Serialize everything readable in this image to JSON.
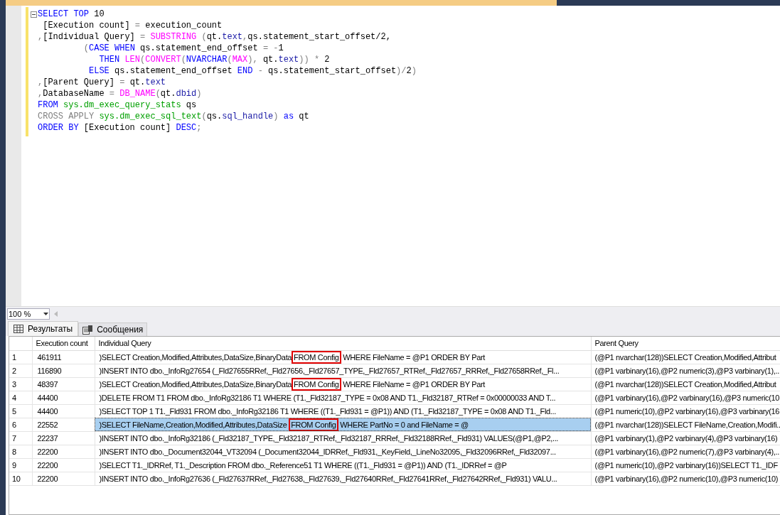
{
  "editor": {
    "lines": [
      [
        {
          "t": "SELECT",
          "kind": "kw"
        },
        {
          "t": " TOP",
          "kind": "kw"
        },
        {
          "t": " 10",
          "kind": "p"
        }
      ],
      [
        {
          "t": " [Execution count] ",
          "kind": "p"
        },
        {
          "t": "=",
          "kind": "op"
        },
        {
          "t": " execution_count",
          "kind": "p"
        }
      ],
      [
        {
          "t": ",",
          "kind": "op"
        },
        {
          "t": "[Individual Query] ",
          "kind": "p"
        },
        {
          "t": "=",
          "kind": "op"
        },
        {
          "t": " SUBSTRING",
          "kind": "fn"
        },
        {
          "t": " (",
          "kind": "op"
        },
        {
          "t": "qt.",
          "kind": "p"
        },
        {
          "t": "text",
          "kind": "id"
        },
        {
          "t": ",",
          "kind": "op"
        },
        {
          "t": "qs.statement_start_offset/2,",
          "kind": "p"
        }
      ],
      [
        {
          "t": "         (",
          "kind": "op"
        },
        {
          "t": "CASE",
          "kind": "kw"
        },
        {
          "t": " WHEN",
          "kind": "kw"
        },
        {
          "t": " qs.statement_end_offset ",
          "kind": "p"
        },
        {
          "t": "= -",
          "kind": "op"
        },
        {
          "t": "1",
          "kind": "p"
        }
      ],
      [
        {
          "t": "            THEN",
          "kind": "kw"
        },
        {
          "t": " LEN",
          "kind": "fn"
        },
        {
          "t": "(",
          "kind": "op"
        },
        {
          "t": "CONVERT",
          "kind": "fn"
        },
        {
          "t": "(",
          "kind": "op"
        },
        {
          "t": "NVARCHAR",
          "kind": "kw"
        },
        {
          "t": "(",
          "kind": "op"
        },
        {
          "t": "MAX",
          "kind": "fn"
        },
        {
          "t": "),",
          "kind": "op"
        },
        {
          "t": " qt.",
          "kind": "p"
        },
        {
          "t": "text",
          "kind": "id"
        },
        {
          "t": ")) *",
          "kind": "op"
        },
        {
          "t": " 2",
          "kind": "p"
        }
      ],
      [
        {
          "t": "          ELSE",
          "kind": "kw"
        },
        {
          "t": " qs.statement_end_offset ",
          "kind": "p"
        },
        {
          "t": "END",
          "kind": "kw"
        },
        {
          "t": " -",
          "kind": "op"
        },
        {
          "t": " qs.statement_start_offset",
          "kind": "p"
        },
        {
          "t": ")/",
          "kind": "op"
        },
        {
          "t": "2",
          "kind": "p"
        },
        {
          "t": ")",
          "kind": "op"
        }
      ],
      [
        {
          "t": ",",
          "kind": "op"
        },
        {
          "t": "[Parent Query] ",
          "kind": "p"
        },
        {
          "t": "=",
          "kind": "op"
        },
        {
          "t": " qt.",
          "kind": "p"
        },
        {
          "t": "text",
          "kind": "id"
        }
      ],
      [
        {
          "t": ",",
          "kind": "op"
        },
        {
          "t": "DatabaseName ",
          "kind": "p"
        },
        {
          "t": "=",
          "kind": "op"
        },
        {
          "t": " DB_NAME",
          "kind": "fn"
        },
        {
          "t": "(",
          "kind": "op"
        },
        {
          "t": "qt.",
          "kind": "p"
        },
        {
          "t": "dbid",
          "kind": "id"
        },
        {
          "t": ")",
          "kind": "op"
        }
      ],
      [
        {
          "t": "FROM",
          "kind": "kw"
        },
        {
          "t": " sys.dm_exec_query_stats",
          "kind": "sys"
        },
        {
          "t": " qs",
          "kind": "p"
        }
      ],
      [
        {
          "t": "CROSS APPLY",
          "kind": "op"
        },
        {
          "t": " sys.dm_exec_sql_text",
          "kind": "sys"
        },
        {
          "t": "(",
          "kind": "op"
        },
        {
          "t": "qs.",
          "kind": "p"
        },
        {
          "t": "sql_handle",
          "kind": "id"
        },
        {
          "t": ")",
          "kind": "op"
        },
        {
          "t": " as",
          "kind": "kw"
        },
        {
          "t": " qt",
          "kind": "p"
        }
      ],
      [
        {
          "t": "ORDER BY",
          "kind": "kw"
        },
        {
          "t": " [Execution count] ",
          "kind": "p"
        },
        {
          "t": "DESC",
          "kind": "kw"
        },
        {
          "t": ";",
          "kind": "op"
        }
      ]
    ]
  },
  "zoom": {
    "value": "100 %"
  },
  "result_tabs": [
    {
      "label": "Результаты",
      "selected": true,
      "kind": "grid"
    },
    {
      "label": "Сообщения",
      "selected": false,
      "kind": "messages"
    }
  ],
  "table": {
    "columns": [
      "Execution count",
      "Individual Query",
      "Parent Query"
    ],
    "rows": [
      {
        "num": "1",
        "count": "461911",
        "query": [
          {
            "t": ")SELECT Creation,Modified,Attributes,DataSize,BinaryData",
            "boxed": false
          },
          {
            "t": "FROM Config",
            "boxed": true
          },
          {
            "t": " WHERE FileName = @P1 ORDER BY Part",
            "boxed": false
          }
        ],
        "parent": "(@P1 nvarchar(128))SELECT Creation,Modified,Attribut",
        "selected": false
      },
      {
        "num": "2",
        "count": "116890",
        "query": [
          {
            "t": ")INSERT INTO dbo._InfoRg27654 (_Fld27655RRef,_Fld27656,_Fld27657_TYPE,_Fld27657_RTRef,_Fld27657_RRRef,_Fld27658RRef,_Fl...",
            "boxed": false
          }
        ],
        "parent": "(@P1 varbinary(16),@P2 numeric(3),@P3 varbinary(1),..",
        "selected": false
      },
      {
        "num": "3",
        "count": "48397",
        "query": [
          {
            "t": ")SELECT Creation,Modified,Attributes,DataSize,BinaryData",
            "boxed": false
          },
          {
            "t": "FROM Config",
            "boxed": true
          },
          {
            "t": " WHERE FileName = @P1 ORDER BY Part",
            "boxed": false
          }
        ],
        "parent": "(@P1 nvarchar(128))SELECT Creation,Modified,Attribut",
        "selected": false
      },
      {
        "num": "4",
        "count": "44400",
        "query": [
          {
            "t": ")DELETE FROM T1 FROM dbo._InfoRg32186 T1 WHERE (T1._Fld32187_TYPE = 0x08 AND T1._Fld32187_RTRef = 0x00000033 AND T...",
            "boxed": false
          }
        ],
        "parent": "(@P1 varbinary(16),@P2 varbinary(16),@P3 numeric(10",
        "selected": false
      },
      {
        "num": "5",
        "count": "44400",
        "query": [
          {
            "t": ")SELECT TOP 1 T1._Fld931 FROM dbo._InfoRg32186 T1 WHERE ((T1._Fld931 = @P1)) AND (T1._Fld32187_TYPE = 0x08 AND T1._Fld...",
            "boxed": false
          }
        ],
        "parent": "(@P1 numeric(10),@P2 varbinary(16),@P3 varbinary(16",
        "selected": false
      },
      {
        "num": "6",
        "count": "22552",
        "query": [
          {
            "t": ")SELECT FileName,Creation,Modified,Attributes,DataSize ",
            "boxed": false
          },
          {
            "t": "FROM Config",
            "boxed": true
          },
          {
            "t": " WHERE PartNo = 0 and FileName = @",
            "boxed": false
          }
        ],
        "parent": "(@P1 nvarchar(128))SELECT FileName,Creation,Modifi..",
        "selected": true
      },
      {
        "num": "7",
        "count": "22237",
        "query": [
          {
            "t": ")INSERT INTO dbo._InfoRg32186 (_Fld32187_TYPE,_Fld32187_RTRef,_Fld32187_RRRef,_Fld32188RRef,_Fld931) VALUES(@P1,@P2,...",
            "boxed": false
          }
        ],
        "parent": "(@P1 varbinary(1),@P2 varbinary(4),@P3 varbinary(16)",
        "selected": false
      },
      {
        "num": "8",
        "count": "22200",
        "query": [
          {
            "t": ")INSERT INTO dbo._Document32044_VT32094 (_Document32044_IDRRef,_Fld931,_KeyField,_LineNo32095,_Fld32096RRef,_Fld32097...",
            "boxed": false
          }
        ],
        "parent": "(@P1 varbinary(16),@P2 numeric(7),@P3 varbinary(4),..",
        "selected": false
      },
      {
        "num": "9",
        "count": "22200",
        "query": [
          {
            "t": ")SELECT T1._IDRRef, T1._Description FROM dbo._Reference51 T1 WHERE ((T1._Fld931 = @P1)) AND (T1._IDRRef = @P",
            "boxed": false
          }
        ],
        "parent": "(@P1 numeric(10),@P2 varbinary(16))SELECT T1._IDF",
        "selected": false
      },
      {
        "num": "10",
        "count": "22200",
        "query": [
          {
            "t": ")INSERT INTO dbo._InfoRg27636 (_Fld27637RRef,_Fld27638,_Fld27639,_Fld27640RRef,_Fld27641RRef,_Fld27642RRef,_Fld931) VALU...",
            "boxed": false
          }
        ],
        "parent": "(@P1 varbinary(16),@P2 numeric(10),@P3 numeric(10)",
        "selected": false
      }
    ]
  }
}
